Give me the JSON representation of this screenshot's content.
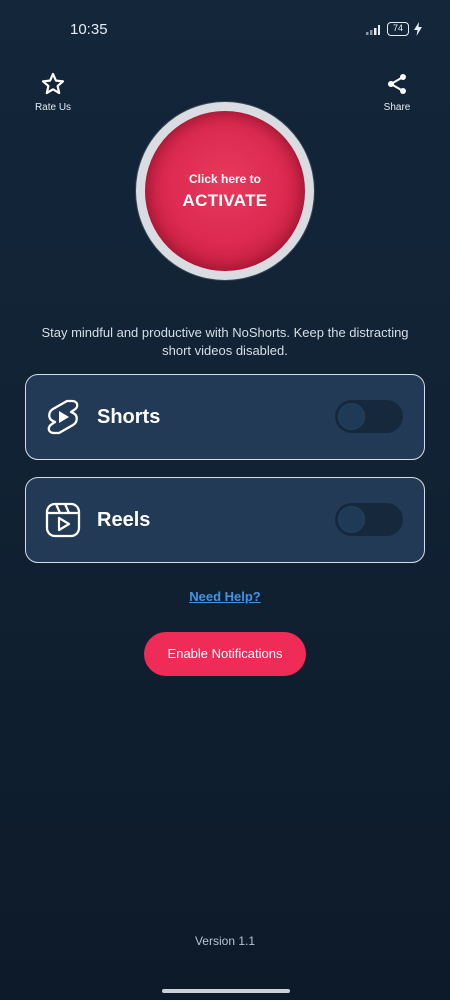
{
  "status_bar": {
    "time": "10:35",
    "battery": "74"
  },
  "top_actions": {
    "rate_label": "Rate Us",
    "share_label": "Share"
  },
  "activate": {
    "line1": "Click here to",
    "line2": "ACTIVATE"
  },
  "tagline": "Stay mindful and productive with NoShorts. Keep the distracting short videos disabled.",
  "cards": [
    {
      "label": "Shorts",
      "enabled": false
    },
    {
      "label": "Reels",
      "enabled": false
    }
  ],
  "help_link": "Need Help?",
  "notify_button": "Enable Notifications",
  "version": "Version 1.1",
  "colors": {
    "accent": "#ef2b57",
    "link": "#3d97e6",
    "card_bg": "#233a56",
    "background": "#12243a"
  }
}
